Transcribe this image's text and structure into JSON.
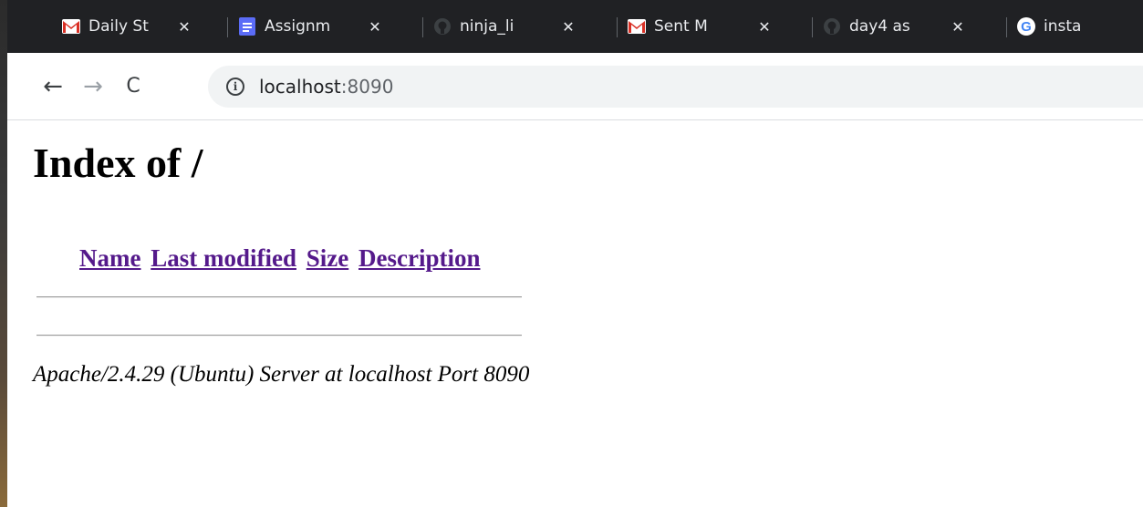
{
  "tabs": [
    {
      "title": "Daily St",
      "icon": "gmail-icon"
    },
    {
      "title": "Assignm",
      "icon": "docs-icon"
    },
    {
      "title": "ninja_li",
      "icon": "github-icon"
    },
    {
      "title": "Sent M",
      "icon": "gmail-icon"
    },
    {
      "title": "day4 as",
      "icon": "github-icon"
    },
    {
      "title": "insta",
      "icon": "google-icon"
    }
  ],
  "toolbar": {
    "back_icon": "←",
    "forward_icon": "→",
    "reload_icon": "C",
    "info_icon": "i",
    "url_host": "localhost",
    "url_rest": ":8090"
  },
  "page": {
    "heading": "Index of /",
    "columns": [
      "Name",
      "Last modified",
      "Size",
      "Description"
    ],
    "footer": "Apache/2.4.29 (Ubuntu) Server at localhost Port 8090"
  },
  "colors": {
    "tabstrip": "#202124",
    "link_visited": "#551a8b",
    "omnibox": "#f1f3f4"
  }
}
